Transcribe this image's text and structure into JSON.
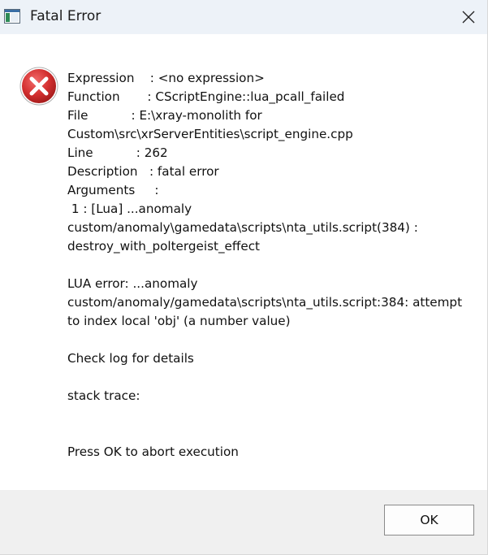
{
  "window": {
    "title": "Fatal Error",
    "icon": "app-window-icon",
    "close_icon": "close-icon"
  },
  "dialog": {
    "icon": "error-icon",
    "lines": [
      "Expression    : <no expression>",
      "Function       : CScriptEngine::lua_pcall_failed",
      "File           : E:\\xray-monolith for",
      "Custom\\src\\xrServerEntities\\script_engine.cpp",
      "Line           : 262",
      "Description   : fatal error",
      "Arguments     :",
      " 1 : [Lua] ...anomaly",
      "custom/anomaly\\gamedata\\scripts\\nta_utils.script(384) :",
      "destroy_with_poltergeist_effect",
      "",
      "LUA error: ...anomaly",
      "custom/anomaly/gamedata\\scripts\\nta_utils.script:384: attempt",
      "to index local 'obj' (a number value)",
      "",
      "Check log for details",
      "",
      "stack trace:",
      "",
      "",
      "Press OK to abort execution"
    ]
  },
  "footer": {
    "ok_label": "OK"
  },
  "colors": {
    "titlebar": "#edf2f8",
    "footer": "#f0f0f0",
    "error_red": "#d32f2f"
  }
}
